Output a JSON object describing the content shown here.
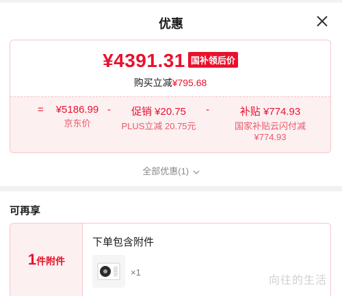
{
  "header": {
    "title": "优惠"
  },
  "price_card": {
    "price": "¥4391.31",
    "badge": "国补领后价",
    "sub_prefix": "购买立减",
    "sub_amount": "¥795.68",
    "calc": {
      "eq": "=",
      "minus1": "-",
      "minus2": "-",
      "jd_value": "¥5186.99",
      "jd_label": "京东价",
      "promo_value": "促销 ¥20.75",
      "promo_label": "PLUS立减 20.75元",
      "subsidy_value": "补贴 ¥774.93",
      "subsidy_label_1": "国家补贴云闪付减",
      "subsidy_label_2": "¥774.93"
    }
  },
  "all_promos": "全部优惠(1)",
  "section": {
    "title": "可再享"
  },
  "accessory": {
    "count_num": "1",
    "count_unit": "件附件",
    "title": "下单包含附件",
    "qty": "×1"
  },
  "watermark": "向往的生活",
  "colors": {
    "accent": "#e8112d",
    "card_border": "#f7c5cb",
    "card_bg": "#fdf0f1"
  }
}
